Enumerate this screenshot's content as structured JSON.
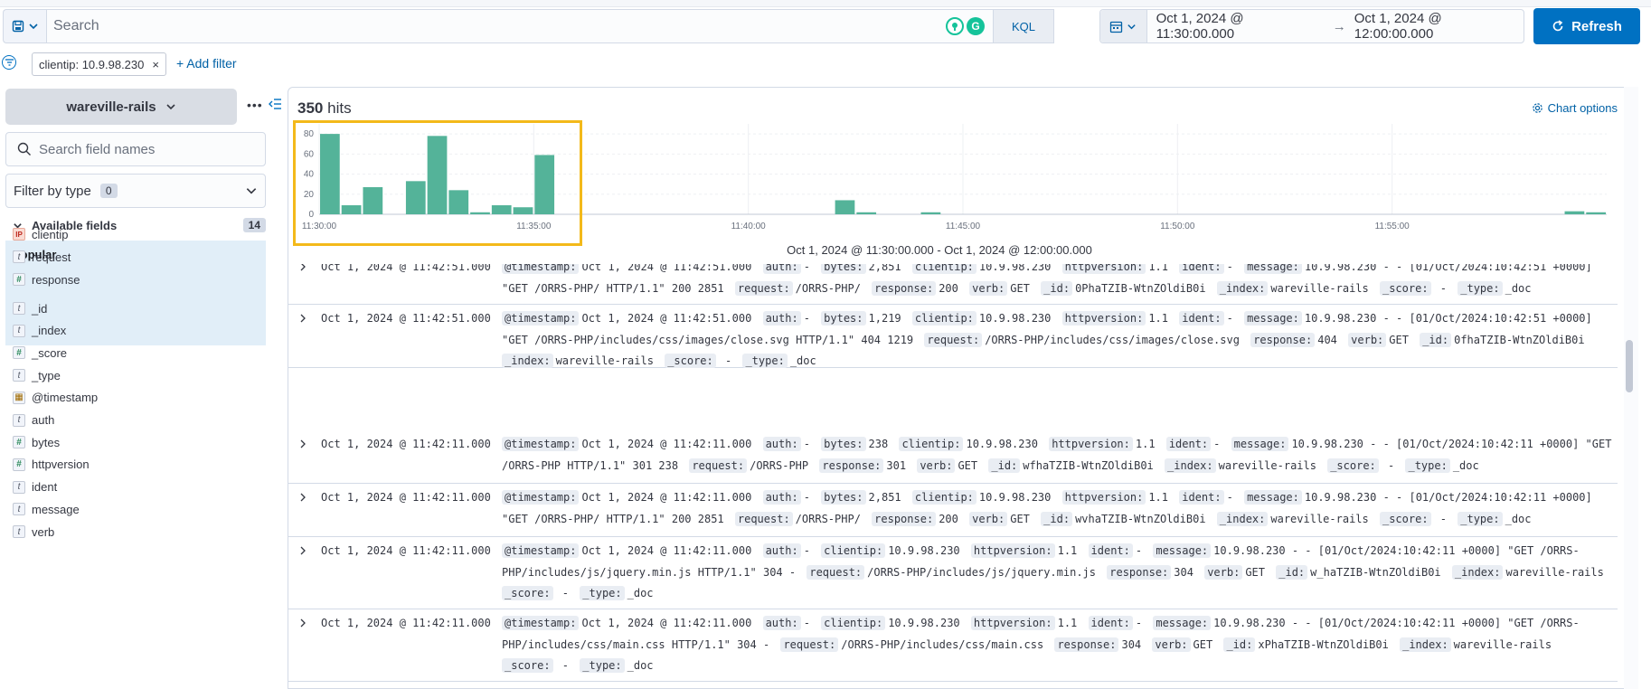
{
  "search": {
    "placeholder": "Search",
    "language": "KQL"
  },
  "timerange": {
    "start": "Oct 1, 2024 @ 11:30:00.000",
    "arrow": "→",
    "end": "Oct 1, 2024 @ 12:00:00.000"
  },
  "refresh_label": "Refresh",
  "filters": [
    {
      "label": "clientip: 10.9.98.230",
      "remove": "×"
    }
  ],
  "add_filter_label": "+ Add filter",
  "sidebar": {
    "index_pattern": "wareville-rails",
    "more": "•••",
    "search_placeholder": "Search field names",
    "filter_by_type": "Filter by type",
    "filter_by_type_count": "0",
    "available_fields": "Available fields",
    "available_count": "14",
    "popular_title": "Popular",
    "popular": [
      {
        "name": "clientip",
        "type": "IP",
        "kind": "ip"
      },
      {
        "name": "request",
        "type": "t",
        "kind": "str"
      },
      {
        "name": "response",
        "type": "#",
        "kind": "num"
      }
    ],
    "fields": [
      {
        "name": "_id",
        "type": "t",
        "kind": "str"
      },
      {
        "name": "_index",
        "type": "t",
        "kind": "str"
      },
      {
        "name": "_score",
        "type": "#",
        "kind": "num"
      },
      {
        "name": "_type",
        "type": "t",
        "kind": "str"
      },
      {
        "name": "@timestamp",
        "type": "▦",
        "kind": "date"
      },
      {
        "name": "auth",
        "type": "t",
        "kind": "str"
      },
      {
        "name": "bytes",
        "type": "#",
        "kind": "num"
      },
      {
        "name": "httpversion",
        "type": "#",
        "kind": "num"
      },
      {
        "name": "ident",
        "type": "t",
        "kind": "str"
      },
      {
        "name": "message",
        "type": "t",
        "kind": "str"
      },
      {
        "name": "verb",
        "type": "t",
        "kind": "str"
      }
    ]
  },
  "hits": {
    "count": "350",
    "label": "hits"
  },
  "chart_options_label": "Chart options",
  "chart_data": {
    "type": "bar",
    "ylim": [
      0,
      90
    ],
    "yticks": [
      0,
      20,
      40,
      60,
      80
    ],
    "xlim_minutes": [
      0,
      30
    ],
    "xticks": [
      {
        "minute": 0,
        "label": "11:30:00"
      },
      {
        "minute": 5,
        "label": "11:35:00"
      },
      {
        "minute": 10,
        "label": "11:40:00"
      },
      {
        "minute": 15,
        "label": "11:45:00"
      },
      {
        "minute": 20,
        "label": "11:50:00"
      },
      {
        "minute": 25,
        "label": "11:55:00"
      }
    ],
    "bucket_minutes": 0.5,
    "bars": [
      {
        "minute": 0.0,
        "value": 80
      },
      {
        "minute": 0.5,
        "value": 9
      },
      {
        "minute": 1.0,
        "value": 27
      },
      {
        "minute": 2.0,
        "value": 33
      },
      {
        "minute": 2.5,
        "value": 78
      },
      {
        "minute": 3.0,
        "value": 24
      },
      {
        "minute": 3.5,
        "value": 2
      },
      {
        "minute": 4.0,
        "value": 9
      },
      {
        "minute": 4.5,
        "value": 7
      },
      {
        "minute": 5.0,
        "value": 59
      },
      {
        "minute": 12.0,
        "value": 14
      },
      {
        "minute": 12.5,
        "value": 2
      },
      {
        "minute": 14.0,
        "value": 2
      },
      {
        "minute": 29.0,
        "value": 3
      },
      {
        "minute": 29.5,
        "value": 2
      }
    ],
    "xlabel": "Oct 1, 2024 @ 11:30:00.000 - Oct 1, 2024 @ 12:00:00.000",
    "color": "#54b399"
  },
  "documents": [
    {
      "time": "Oct 1, 2024 @ 11:42:51.000",
      "fields": [
        [
          "@timestamp:",
          "Oct 1, 2024 @ 11:42:51.000"
        ],
        [
          "auth:",
          "-"
        ],
        [
          "bytes:",
          "2,851"
        ],
        [
          "clientip:",
          "10.9.98.230"
        ],
        [
          "httpversion:",
          "1.1"
        ],
        [
          "ident:",
          "-"
        ],
        [
          "message:",
          "10.9.98.230 - - [01/Oct/2024:10:42:51 +0000] \"GET /ORRS-PHP/ HTTP/1.1\" 200 2851"
        ],
        [
          "request:",
          "/ORRS-PHP/"
        ],
        [
          "response:",
          "200"
        ],
        [
          "verb:",
          "GET"
        ],
        [
          "_id:",
          "0PhaTZIB-WtnZOldiB0i"
        ],
        [
          "_index:",
          "wareville-rails"
        ],
        [
          "_score:",
          " - "
        ],
        [
          "_type:",
          "_doc"
        ]
      ]
    },
    {
      "time": "Oct 1, 2024 @ 11:42:51.000",
      "fields": [
        [
          "@timestamp:",
          "Oct 1, 2024 @ 11:42:51.000"
        ],
        [
          "auth:",
          "-"
        ],
        [
          "bytes:",
          "1,219"
        ],
        [
          "clientip:",
          "10.9.98.230"
        ],
        [
          "httpversion:",
          "1.1"
        ],
        [
          "ident:",
          "-"
        ],
        [
          "message:",
          "10.9.98.230 - - [01/Oct/2024:10:42:51 +0000] \"GET /ORRS-PHP/includes/css/images/close.svg HTTP/1.1\" 404 1219"
        ],
        [
          "request:",
          "/ORRS-PHP/includes/css/images/close.svg"
        ],
        [
          "response:",
          "404"
        ],
        [
          "verb:",
          "GET"
        ],
        [
          "_id:",
          "0fhaTZIB-WtnZOldiB0i"
        ],
        [
          "_index:",
          "wareville-rails"
        ],
        [
          "_score:",
          " - "
        ],
        [
          "_type:",
          "_doc"
        ]
      ]
    },
    {
      "time": "Oct 1, 2024 @ 11:42:11.000",
      "fields": [
        [
          "@timestamp:",
          "Oct 1, 2024 @ 11:42:11.000"
        ],
        [
          "auth:",
          "-"
        ],
        [
          "bytes:",
          "238"
        ],
        [
          "clientip:",
          "10.9.98.230"
        ],
        [
          "httpversion:",
          "1.1"
        ],
        [
          "ident:",
          "-"
        ],
        [
          "message:",
          "10.9.98.230 - - [01/Oct/2024:10:42:11 +0000] \"GET /ORRS-PHP HTTP/1.1\" 301 238"
        ],
        [
          "request:",
          "/ORRS-PHP"
        ],
        [
          "response:",
          "301"
        ],
        [
          "verb:",
          "GET"
        ],
        [
          "_id:",
          "wfhaTZIB-WtnZOldiB0i"
        ],
        [
          "_index:",
          "wareville-rails"
        ],
        [
          "_score:",
          " - "
        ],
        [
          "_type:",
          "_doc"
        ]
      ]
    },
    {
      "time": "Oct 1, 2024 @ 11:42:11.000",
      "fields": [
        [
          "@timestamp:",
          "Oct 1, 2024 @ 11:42:11.000"
        ],
        [
          "auth:",
          "-"
        ],
        [
          "bytes:",
          "2,851"
        ],
        [
          "clientip:",
          "10.9.98.230"
        ],
        [
          "httpversion:",
          "1.1"
        ],
        [
          "ident:",
          "-"
        ],
        [
          "message:",
          "10.9.98.230 - - [01/Oct/2024:10:42:11 +0000] \"GET /ORRS-PHP/ HTTP/1.1\" 200 2851"
        ],
        [
          "request:",
          "/ORRS-PHP/"
        ],
        [
          "response:",
          "200"
        ],
        [
          "verb:",
          "GET"
        ],
        [
          "_id:",
          "wvhaTZIB-WtnZOldiB0i"
        ],
        [
          "_index:",
          "wareville-rails"
        ],
        [
          "_score:",
          " - "
        ],
        [
          "_type:",
          "_doc"
        ]
      ]
    },
    {
      "time": "Oct 1, 2024 @ 11:42:11.000",
      "fields": [
        [
          "@timestamp:",
          "Oct 1, 2024 @ 11:42:11.000"
        ],
        [
          "auth:",
          "-"
        ],
        [
          "clientip:",
          "10.9.98.230"
        ],
        [
          "httpversion:",
          "1.1"
        ],
        [
          "ident:",
          "-"
        ],
        [
          "message:",
          "10.9.98.230 - - [01/Oct/2024:10:42:11 +0000] \"GET /ORRS-PHP/includes/js/jquery.min.js HTTP/1.1\" 304 -"
        ],
        [
          "request:",
          "/ORRS-PHP/includes/js/jquery.min.js"
        ],
        [
          "response:",
          "304"
        ],
        [
          "verb:",
          "GET"
        ],
        [
          "_id:",
          "w_haTZIB-WtnZOldiB0i"
        ],
        [
          "_index:",
          "wareville-rails"
        ],
        [
          "_score:",
          " - "
        ],
        [
          "_type:",
          "_doc"
        ]
      ]
    },
    {
      "time": "Oct 1, 2024 @ 11:42:11.000",
      "fields": [
        [
          "@timestamp:",
          "Oct 1, 2024 @ 11:42:11.000"
        ],
        [
          "auth:",
          "-"
        ],
        [
          "clientip:",
          "10.9.98.230"
        ],
        [
          "httpversion:",
          "1.1"
        ],
        [
          "ident:",
          "-"
        ],
        [
          "message:",
          "10.9.98.230 - - [01/Oct/2024:10:42:11 +0000] \"GET /ORRS-PHP/includes/css/main.css HTTP/1.1\" 304 -"
        ],
        [
          "request:",
          "/ORRS-PHP/includes/css/main.css"
        ],
        [
          "response:",
          "304"
        ],
        [
          "verb:",
          "GET"
        ],
        [
          "_id:",
          "xPhaTZIB-WtnZOldiB0i"
        ],
        [
          "_index:",
          "wareville-rails"
        ],
        [
          "_score:",
          " - "
        ],
        [
          "_type:",
          "_doc"
        ]
      ]
    }
  ]
}
